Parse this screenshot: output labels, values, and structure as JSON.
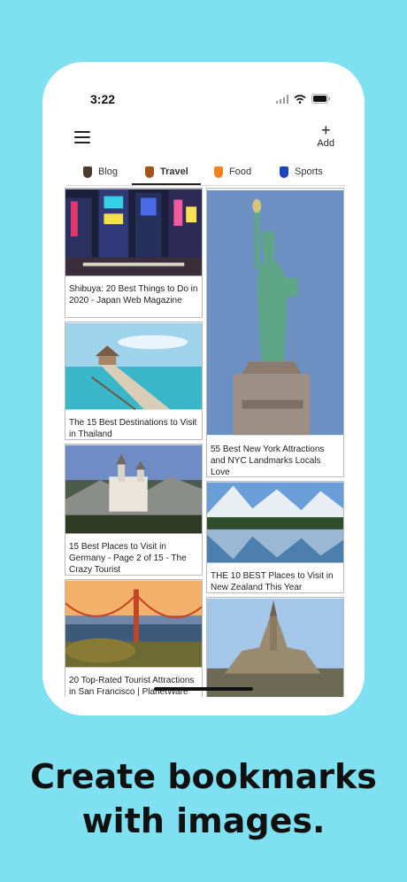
{
  "status": {
    "time": "3:22"
  },
  "topbar": {
    "add_label": "Add"
  },
  "tabs": [
    {
      "label": "Blog",
      "color": "#4a3b33"
    },
    {
      "label": "Travel",
      "color": "#a5521a",
      "active": true
    },
    {
      "label": "Food",
      "color": "#f5821f"
    },
    {
      "label": "Sports",
      "color": "#1a46b8"
    }
  ],
  "cards": [
    {
      "title": "Shibuya: 20 Best Things to Do in 2020 - Japan Web Magazine"
    },
    {
      "title": "The 15 Best Destinations to Visit in Thailand"
    },
    {
      "title": "15 Best Places to Visit in Germany - Page 2 of 15 - The Crazy Tourist"
    },
    {
      "title": "20 Top-Rated Tourist Attractions in San Francisco | PlanetWare"
    },
    {
      "title": "55 Best New York Attractions and NYC Landmarks Locals Love"
    },
    {
      "title": "THE 10 BEST Places to Visit in New Zealand This Year"
    },
    {
      "title": ""
    }
  ],
  "headline": {
    "line1": "Create bookmarks",
    "line2": "with images."
  },
  "colors": {
    "background": "#7fe0f2"
  }
}
